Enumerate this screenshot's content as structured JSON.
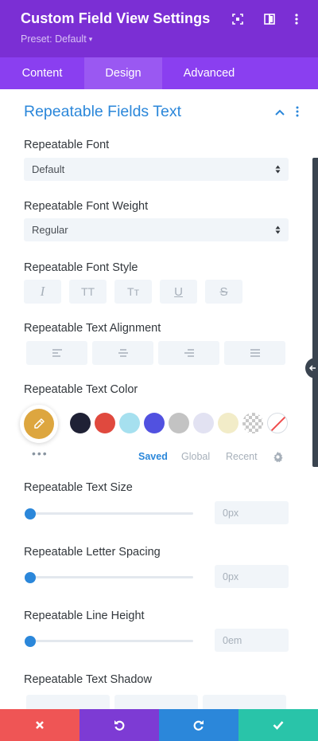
{
  "header": {
    "title": "Custom Field View Settings",
    "preset": "Preset: Default",
    "icons": [
      "fullscreen-icon",
      "split-view-icon",
      "more-options-icon"
    ]
  },
  "tabs": [
    {
      "label": "Content",
      "active": false
    },
    {
      "label": "Design",
      "active": true
    },
    {
      "label": "Advanced",
      "active": false
    }
  ],
  "section": {
    "title": "Repeatable Fields Text",
    "expanded": true
  },
  "fields": {
    "font": {
      "label": "Repeatable Font",
      "value": "Default"
    },
    "font_weight": {
      "label": "Repeatable Font Weight",
      "value": "Regular"
    },
    "font_style": {
      "label": "Repeatable Font Style",
      "buttons": [
        "I",
        "TT",
        "Tт",
        "U",
        "S"
      ]
    },
    "alignment": {
      "label": "Repeatable Text Alignment",
      "options": [
        "left",
        "center",
        "right",
        "justify"
      ]
    },
    "color": {
      "label": "Repeatable Text Color",
      "current": "#dda63f",
      "swatches": [
        "#1f2135",
        "#e0493e",
        "#a6e0ef",
        "#5151e0",
        "#c3c3c3",
        "#e2e2f2",
        "#f2ecc8",
        "transparent",
        "none"
      ],
      "palette_tabs": [
        "Saved",
        "Global",
        "Recent"
      ],
      "active_palette": "Saved"
    },
    "text_size": {
      "label": "Repeatable Text Size",
      "value": "0px",
      "level": 0
    },
    "letter_spacing": {
      "label": "Repeatable Letter Spacing",
      "value": "0px",
      "level": 0
    },
    "line_height": {
      "label": "Repeatable Line Height",
      "value": "0em",
      "level": 0
    },
    "text_shadow": {
      "label": "Repeatable Text Shadow"
    }
  },
  "footer": {
    "buttons": [
      {
        "name": "discard",
        "color": "#ef5555"
      },
      {
        "name": "undo",
        "color": "#7d3bd4"
      },
      {
        "name": "redo",
        "color": "#2b87da"
      },
      {
        "name": "save",
        "color": "#29c4a9"
      }
    ]
  },
  "colors": {
    "header_bg": "#7b2fd4",
    "tabs_bg": "#8a3ff0",
    "active_tab_bg": "#9a58f2",
    "accent": "#2b87da"
  }
}
